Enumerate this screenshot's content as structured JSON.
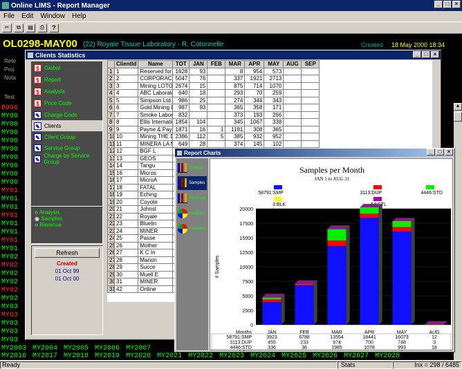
{
  "app": {
    "title": "Online LIMS - Report Manager",
    "menu": [
      "File",
      "Edit",
      "Window",
      "Help"
    ]
  },
  "header": {
    "code": "OL0298-MAY00",
    "lab": "(22) Royale Tissue Laboratory - R. Cotonnelle",
    "created_label": "Created",
    "created_date": "18 May 2000 18:34"
  },
  "bg_labels": [
    "Refe",
    "Proj",
    "Nota",
    "Test"
  ],
  "bg_list_left": [
    "B996",
    "MY00",
    "MY00",
    "MY00",
    "MY00",
    "MY00",
    "MY00",
    "MY00",
    "MY00",
    "MY00",
    "MY01",
    "MY01",
    "MY01",
    "MY01",
    "MY01",
    "MY01",
    "MY01",
    "MY01",
    "MY02",
    "MY02",
    "MY02",
    "MY02",
    "MY02",
    "MY02",
    "MY03",
    "MY03",
    "MY03",
    "MY03",
    "MY03"
  ],
  "bg_rows": [
    [
      "MY2003",
      "MY2004",
      "MY2005",
      "MY2006",
      "MY2007"
    ],
    [
      "MY2016",
      "MY2017",
      "MY2018",
      "MY2019",
      "MY2020",
      "MY2021",
      "MY2022",
      "MY2023",
      "MY2024",
      "MY2025",
      "MY2026",
      "MY2027",
      "MY2028"
    ]
  ],
  "status": {
    "left": "Ready",
    "mid": "Stats",
    "right": "Inx = 298 / 6485"
  },
  "clients_window": {
    "title": "Clients Statistics",
    "menu_items": [
      {
        "label": "Global",
        "icon": "dollar-icon"
      },
      {
        "label": "Report",
        "icon": "dollar-icon"
      },
      {
        "label": "Analysis",
        "icon": "dollar-icon"
      },
      {
        "label": "Price Code",
        "icon": "dollar-icon"
      },
      {
        "label": "Charge Code",
        "icon": "wrench-icon"
      },
      {
        "label": "Clients",
        "icon": "wrench-icon"
      },
      {
        "label": "Client Group",
        "icon": "wrench-icon"
      },
      {
        "label": "Service Group",
        "icon": "wrench-icon"
      },
      {
        "label": "Charge by Service Group",
        "icon": "wrench-icon"
      }
    ],
    "selected_item": "Clients",
    "radio_options": [
      "Analysis",
      "Samples",
      "Revenue"
    ],
    "refresh_label": "Refresh",
    "created_label": "Created",
    "created_dates": [
      "01 Oct 99",
      "01 Oct 00"
    ],
    "columns": [
      "",
      "ClientId",
      "Name",
      "TOT",
      "JAN",
      "FEB",
      "MAR",
      "APR",
      "MAY",
      "AUG",
      "SEP"
    ],
    "rows": [
      [
        "1",
        "1",
        "Reserved for m",
        "1628",
        "93",
        "",
        "8",
        "954",
        "573",
        "",
        ""
      ],
      [
        "2",
        "2",
        "CORPORACIO",
        "5047",
        "76",
        "",
        "337",
        "1921",
        "2713",
        "",
        ""
      ],
      [
        "3",
        "3",
        "Mining LOTOF",
        "2674",
        "15",
        "",
        "875",
        "714",
        "1070",
        "",
        ""
      ],
      [
        "4",
        "4",
        "ABC Laborator",
        "640",
        "18",
        "",
        "293",
        "70",
        "259",
        "",
        ""
      ],
      [
        "5",
        "5",
        "Simpson Ltd.",
        "986",
        "25",
        "",
        "274",
        "344",
        "343",
        "",
        ""
      ],
      [
        "6",
        "6",
        "Gold Mining Lt",
        "987",
        "93",
        "",
        "365",
        "358",
        "171",
        "",
        ""
      ],
      [
        "7",
        "7",
        "Smoke Labora",
        "832",
        "",
        "",
        "373",
        "193",
        "266",
        "",
        ""
      ],
      [
        "8",
        "8",
        "Ellis Internatio",
        "1854",
        "104",
        "",
        "345",
        "1067",
        "338",
        "",
        ""
      ],
      [
        "9",
        "9",
        "Payne & Payn",
        "1871",
        "16",
        "1",
        "1181",
        "308",
        "365",
        "",
        ""
      ],
      [
        "10",
        "10",
        "Mining THE D",
        "2386",
        "112",
        "5",
        "385",
        "932",
        "952",
        "",
        ""
      ],
      [
        "11",
        "11",
        "MINERA LA M",
        "649",
        "28",
        "",
        "374",
        "145",
        "102",
        "",
        ""
      ],
      [
        "12",
        "12",
        "BGF L",
        "",
        "",
        "",
        "",
        "",
        "",
        "",
        ""
      ],
      [
        "13",
        "13",
        "GEOS",
        "",
        "",
        "",
        "",
        "",
        "",
        "",
        ""
      ],
      [
        "14",
        "14",
        "Tangu",
        "",
        "",
        "",
        "",
        "",
        "",
        "",
        ""
      ],
      [
        "15",
        "16",
        "Micros",
        "",
        "",
        "",
        "",
        "",
        "",
        "",
        ""
      ],
      [
        "16",
        "17",
        "MicroA",
        "",
        "",
        "",
        "",
        "",
        "",
        "",
        ""
      ],
      [
        "17",
        "18",
        "FATAL",
        "",
        "",
        "",
        "",
        "",
        "",
        "",
        ""
      ],
      [
        "18",
        "19",
        "Eching",
        "",
        "",
        "",
        "",
        "",
        "",
        "",
        ""
      ],
      [
        "19",
        "20",
        "Coyote",
        "",
        "",
        "",
        "",
        "",
        "",
        "",
        ""
      ],
      [
        "20",
        "21",
        "Johnst",
        "",
        "",
        "",
        "",
        "",
        "",
        "",
        ""
      ],
      [
        "21",
        "22",
        "Royale",
        "",
        "",
        "",
        "",
        "",
        "",
        "",
        ""
      ],
      [
        "22",
        "23",
        "Bluelin",
        "",
        "",
        "",
        "",
        "",
        "",
        "",
        ""
      ],
      [
        "23",
        "24",
        "MINER",
        "",
        "",
        "",
        "",
        "",
        "",
        "",
        ""
      ],
      [
        "24",
        "25",
        "Passe",
        "",
        "",
        "",
        "",
        "",
        "",
        "",
        ""
      ],
      [
        "25",
        "26",
        "Mother",
        "",
        "",
        "",
        "",
        "",
        "",
        "",
        ""
      ],
      [
        "26",
        "27",
        "K C In",
        "",
        "",
        "",
        "",
        "",
        "",
        "",
        ""
      ],
      [
        "27",
        "28",
        "Marion",
        "",
        "",
        "",
        "",
        "",
        "",
        "",
        ""
      ],
      [
        "28",
        "29",
        "Succe",
        "",
        "",
        "",
        "",
        "",
        "",
        "",
        ""
      ],
      [
        "29",
        "30",
        "Muell E",
        "",
        "",
        "",
        "",
        "",
        "",
        "",
        ""
      ],
      [
        "30",
        "31",
        "MINER",
        "",
        "",
        "",
        "",
        "",
        "",
        "",
        ""
      ],
      [
        "31",
        "42",
        "Online",
        "",
        "",
        "",
        "",
        "",
        "",
        "",
        ""
      ]
    ]
  },
  "report_window": {
    "title": "Report Charts",
    "side_buttons": [
      {
        "label": "Analysis",
        "icon": "bar-chart-icon"
      },
      {
        "label": "Samples",
        "icon": "bar-chart-icon"
      },
      {
        "label": "Revenue",
        "icon": "bar-chart-icon"
      },
      {
        "label": "Analysis",
        "icon": "pie-chart-icon"
      },
      {
        "label": "Samples",
        "icon": "pie-chart-icon"
      }
    ],
    "active_button": 1
  },
  "chart_data": {
    "type": "bar",
    "title": "Samples per Month",
    "subtitle": "JAN 1 to AUG 31",
    "xlabel": "Months",
    "ylabel": "# Samples",
    "ylim": [
      0,
      20000
    ],
    "yticks": [
      0,
      2500,
      5000,
      7500,
      10000,
      12500,
      15000,
      17500,
      20000
    ],
    "categories": [
      "JAN",
      "FEB",
      "MAR",
      "APR",
      "MAY",
      "AUG"
    ],
    "stacked": true,
    "series": [
      {
        "name": "58791:SMP",
        "color": "#1010ff",
        "values": [
          3923,
          6788,
          13554,
          18441,
          16073,
          12
        ]
      },
      {
        "name": "3113:DUP",
        "color": "#ff0000",
        "values": [
          455,
          233,
          974,
          700,
          748,
          3
        ]
      },
      {
        "name": "4446:STD",
        "color": "#00ee00",
        "values": [
          336,
          36,
          1985,
          1078,
          993,
          18
        ]
      },
      {
        "name": "3:BLK",
        "color": "#ffff00",
        "values": [
          null,
          null,
          null,
          null,
          3,
          null
        ]
      },
      {
        "name": "64:CTL",
        "color": "#aa00aa",
        "values": [
          33,
          17,
          14,
          null,
          null,
          null
        ]
      }
    ],
    "table_rows": [
      [
        "58791:SMP",
        "3923",
        "6788",
        "13554",
        "18441",
        "16073",
        "12"
      ],
      [
        "3113:DUP",
        "455",
        "233",
        "974",
        "700",
        "748",
        "3"
      ],
      [
        "4446:STD",
        "336",
        "36",
        "1985",
        "1078",
        "993",
        "18"
      ],
      [
        "3:BLK",
        "",
        "",
        "",
        "",
        "3",
        ""
      ],
      [
        "64:CTL",
        "33",
        "17",
        "14",
        "",
        "",
        ""
      ]
    ],
    "grid": true,
    "legend": "top"
  }
}
